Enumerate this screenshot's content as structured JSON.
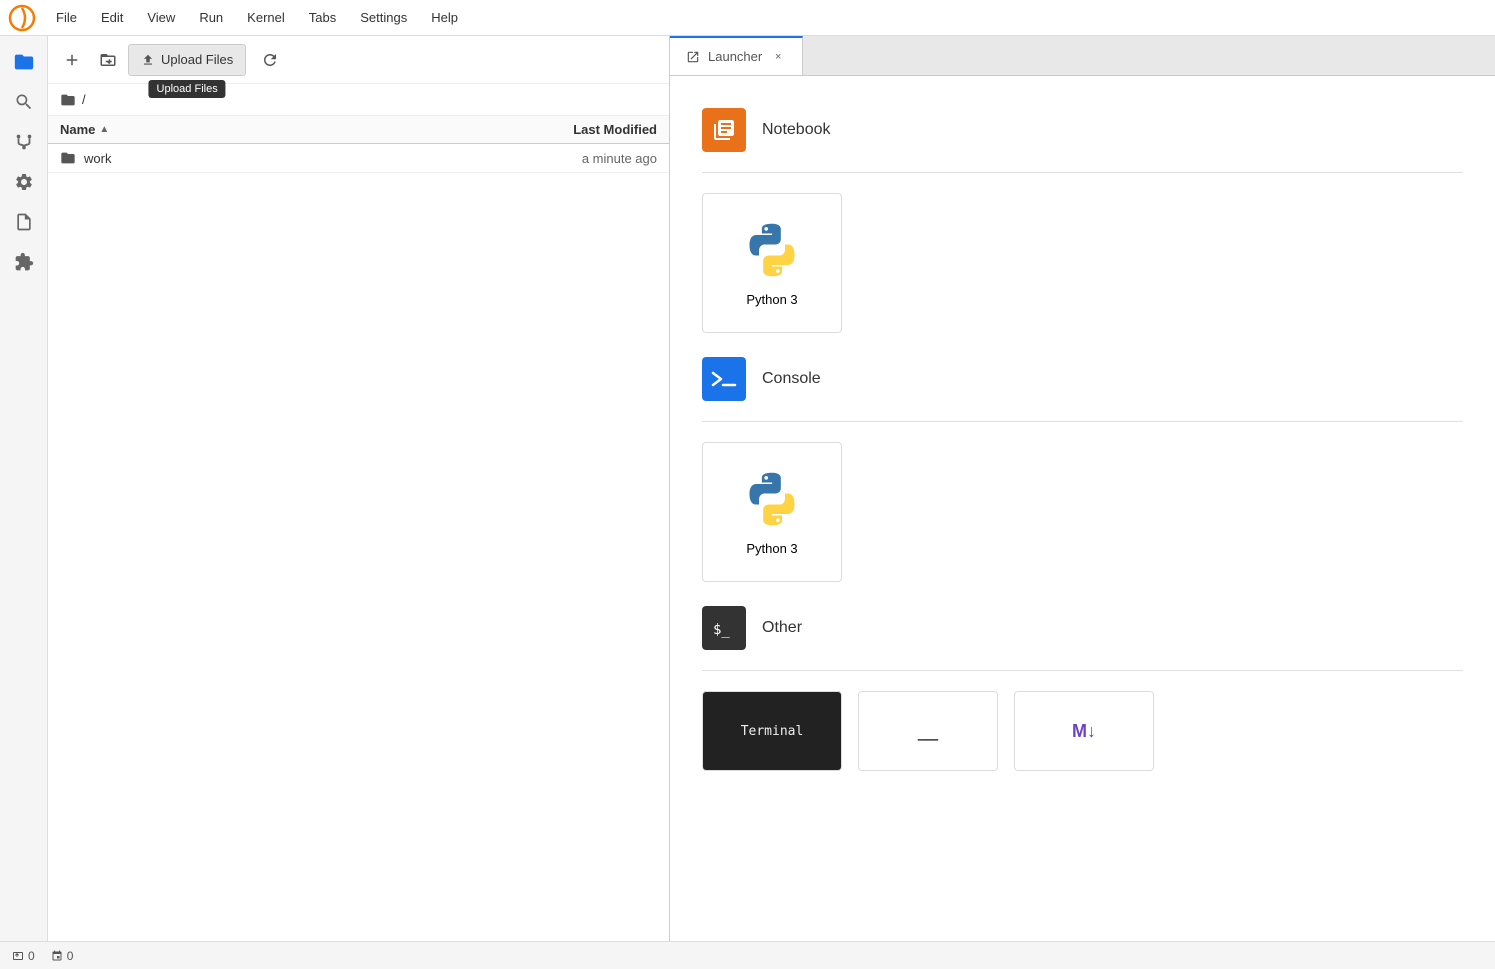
{
  "menubar": {
    "items": [
      "File",
      "Edit",
      "View",
      "Run",
      "Kernel",
      "Tabs",
      "Settings",
      "Help"
    ]
  },
  "activity_bar": {
    "icons": [
      {
        "name": "folder-icon",
        "symbol": "📁",
        "active": true
      },
      {
        "name": "search-icon",
        "symbol": "🔍",
        "active": false
      },
      {
        "name": "git-icon",
        "symbol": "⎇",
        "active": false
      },
      {
        "name": "debug-icon",
        "symbol": "⚙",
        "active": false
      },
      {
        "name": "page-icon",
        "symbol": "📄",
        "active": false
      },
      {
        "name": "puzzle-icon",
        "symbol": "🧩",
        "active": false
      }
    ]
  },
  "file_panel": {
    "toolbar": {
      "new_file_label": "+",
      "new_folder_label": "📁+",
      "upload_label": "Upload Files",
      "refresh_label": "↺"
    },
    "breadcrumb": "/",
    "columns": {
      "name": "Name",
      "modified": "Last Modified"
    },
    "files": [
      {
        "name": "work",
        "modified": "a minute ago",
        "is_folder": true
      }
    ]
  },
  "tabs": [
    {
      "label": "Launcher",
      "icon": "launcher-icon",
      "active": true,
      "close": "×"
    }
  ],
  "launcher": {
    "notebook_section": "Notebook",
    "notebook_icon_color": "#E8711A",
    "python3_label": "Python 3",
    "console_section": "Console",
    "console_icon_color": "#1a73e8",
    "other_section": "Other",
    "other_icon_color": "#333"
  },
  "statusbar": {
    "terminal_count": "0",
    "kernel_count": "0"
  }
}
